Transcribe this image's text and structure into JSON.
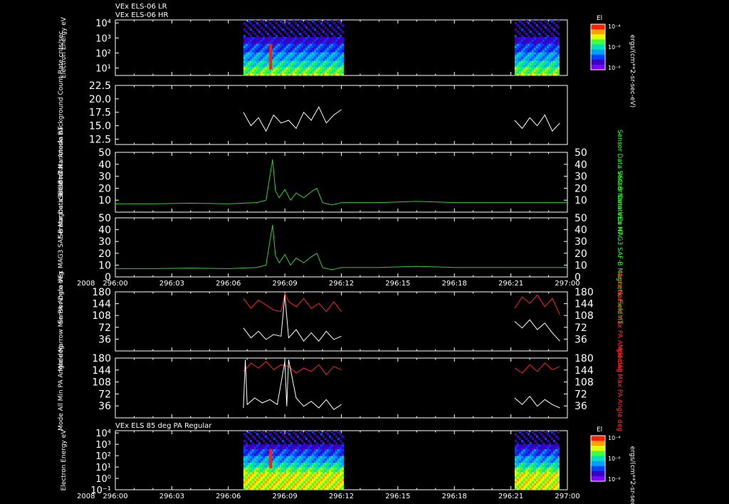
{
  "header": {
    "line1": "VEx ELS-06 LR",
    "line2": "VEx ELS-06 HR",
    "lower_title": "VEx ELS 85 deg PA Regular"
  },
  "colorbars": [
    {
      "label": "El",
      "ticks": [
        "10⁻⁴",
        "10⁻⁶",
        "10⁻⁸"
      ],
      "unit": "ergs/(cm**2-sr-sec-eV)"
    },
    {
      "label": "El",
      "ticks": [
        "10⁻⁴",
        "10⁻⁶",
        "10⁻⁸"
      ],
      "unit": "ergs/(cm**2-sr-sec-eV)"
    }
  ],
  "time_axis": {
    "year": "2008",
    "ticks": [
      "296:00",
      "296:03",
      "296:06",
      "296:09",
      "296:12",
      "296:15",
      "296:18",
      "296:21",
      "297:00"
    ],
    "range_hours": [
      0,
      24
    ]
  },
  "chart_data": [
    {
      "type": "heatmap",
      "id": "spec_top",
      "ylabel": "Electron Energy eV",
      "yticks": [
        "10⁴",
        "10³",
        "10²",
        "10¹"
      ],
      "y_log_range": [
        0.5,
        4.2
      ],
      "intervals": [
        [
          6.8,
          12.1
        ],
        [
          21.2,
          23.6
        ]
      ],
      "features": [
        {
          "x": 8.25,
          "label": "peak"
        }
      ]
    },
    {
      "type": "line",
      "id": "background",
      "ylabel": "Sensor Data Anode Background Count Rate cnts/sec",
      "ylim": [
        11.5,
        22.5
      ],
      "yticks": [
        12.5,
        15.0,
        17.5,
        20.0,
        22.5
      ],
      "ytick_labels": [
        "12.5",
        "15.0",
        "17.5",
        "20.0",
        "22.5"
      ],
      "color": "#ffffff",
      "series": [
        {
          "x": [
            6.8,
            7.2,
            7.6,
            8.0,
            8.4,
            8.8,
            9.2,
            9.6,
            10.0,
            10.4,
            10.8,
            11.2,
            11.6,
            12.0
          ],
          "values": [
            17.5,
            15.0,
            16.5,
            14.0,
            17.0,
            15.5,
            16.0,
            14.5,
            17.5,
            16.0,
            18.5,
            15.5,
            17.0,
            18.0
          ]
        },
        {
          "x": [
            21.2,
            21.6,
            22.0,
            22.4,
            22.8,
            23.2,
            23.6
          ],
          "values": [
            16.0,
            14.5,
            16.5,
            15.0,
            17.0,
            14.0,
            15.5
          ]
        }
      ]
    },
    {
      "type": "line",
      "id": "bmag_vso",
      "ylabel": "Sensor Data S/C Btot Nanotesla nT",
      "ylabel_right": "Sensor Data VSO B Nanotesla nT",
      "ylim": [
        0,
        50
      ],
      "yticks": [
        10,
        20,
        30,
        40,
        50
      ],
      "ytick_labels": [
        "10",
        "20",
        "30",
        "40",
        "50"
      ],
      "color": "#33cc33",
      "series": [
        {
          "x": [
            0,
            2,
            4,
            6,
            7.5,
            8.0,
            8.2,
            8.35,
            8.5,
            8.7,
            9.0,
            9.3,
            9.6,
            10.0,
            10.4,
            10.7,
            11.0,
            11.5,
            12,
            14,
            16,
            18,
            20,
            22,
            24
          ],
          "values": [
            7,
            7,
            7.5,
            7,
            8,
            10,
            30,
            44,
            18,
            12,
            19,
            10,
            16,
            12,
            17,
            20,
            8,
            6,
            8,
            8,
            9,
            8,
            8,
            8,
            8
          ]
        }
      ]
    },
    {
      "type": "line",
      "id": "bmag_mag3",
      "ylabel": "Sensor Data VEx MAG3 SAF-B Magnetic Field nT",
      "ylabel_right": "Sensor Data VEx MAG3 SAF-B Magnetic Field nT",
      "ylim": [
        0,
        50
      ],
      "yticks": [
        0,
        10,
        20,
        30,
        40,
        50
      ],
      "ytick_labels": [
        "0",
        "10",
        "20",
        "30",
        "40",
        "50"
      ],
      "color": "#33cc33",
      "series": [
        {
          "x": [
            0,
            2,
            4,
            6,
            7.5,
            8.0,
            8.2,
            8.35,
            8.5,
            8.7,
            9.0,
            9.3,
            9.6,
            10.0,
            10.4,
            10.7,
            11.0,
            11.5,
            12,
            14,
            16,
            18,
            20,
            22,
            24
          ],
          "values": [
            7,
            7,
            7.5,
            7,
            8,
            10,
            30,
            44,
            18,
            12,
            19,
            10,
            16,
            12,
            17,
            20,
            8,
            6,
            8,
            8,
            9,
            8,
            8,
            8,
            8
          ]
        }
      ]
    },
    {
      "type": "line",
      "id": "narrow_pa",
      "ylabel": "Mode Narrow Min PA Angle deg",
      "ylabel_right": "Mode Narrow Max PA Angle deg",
      "ylim": [
        0,
        180
      ],
      "yticks": [
        36,
        72,
        108,
        144,
        180
      ],
      "ytick_labels": [
        "36",
        "72",
        "108",
        "144",
        "180"
      ],
      "series": [
        {
          "color": "#ff2020",
          "x": [
            6.8,
            7.2,
            7.6,
            8.0,
            8.4,
            8.8,
            9.0,
            9.2,
            9.6,
            10.0,
            10.4,
            10.8,
            11.2,
            11.6,
            12.0
          ],
          "values": [
            160,
            130,
            155,
            140,
            125,
            120,
            175,
            150,
            135,
            160,
            130,
            145,
            120,
            150,
            120
          ]
        },
        {
          "color": "#ff2020",
          "x": [
            21.2,
            21.6,
            22.0,
            22.4,
            22.8,
            23.2,
            23.6
          ],
          "values": [
            130,
            165,
            145,
            170,
            135,
            160,
            110
          ]
        },
        {
          "color": "#ffffff",
          "x": [
            6.8,
            7.2,
            7.6,
            8.0,
            8.4,
            8.8,
            9.0,
            9.2,
            9.6,
            10.0,
            10.4,
            10.8,
            11.2,
            11.6,
            12.0
          ],
          "values": [
            70,
            40,
            60,
            35,
            50,
            45,
            170,
            40,
            65,
            30,
            55,
            30,
            60,
            35,
            45
          ]
        },
        {
          "color": "#ffffff",
          "x": [
            21.2,
            21.6,
            22.0,
            22.4,
            22.8,
            23.2,
            23.6
          ],
          "values": [
            90,
            70,
            95,
            65,
            85,
            55,
            30
          ]
        }
      ]
    },
    {
      "type": "line",
      "id": "all_pa",
      "ylabel": "Mode All Min PA Angle deg",
      "ylabel_right": "Mode All Max PA Angle deg",
      "ylim": [
        0,
        180
      ],
      "yticks": [
        36,
        72,
        108,
        144,
        180
      ],
      "ytick_labels": [
        "36",
        "72",
        "108",
        "144",
        "180"
      ],
      "series": [
        {
          "color": "#ff2020",
          "x": [
            6.8,
            7.2,
            7.6,
            8.0,
            8.4,
            8.8,
            9.2,
            9.6,
            10.0,
            10.4,
            10.8,
            11.2,
            11.6,
            12.0
          ],
          "values": [
            140,
            165,
            150,
            170,
            145,
            160,
            155,
            135,
            150,
            140,
            160,
            130,
            155,
            145
          ]
        },
        {
          "color": "#ff2020",
          "x": [
            21.2,
            21.6,
            22.0,
            22.4,
            22.8,
            23.2,
            23.6
          ],
          "values": [
            150,
            135,
            160,
            140,
            165,
            145,
            155
          ]
        },
        {
          "color": "#ffffff",
          "x": [
            6.8,
            6.9,
            7.0,
            7.4,
            7.8,
            8.2,
            8.6,
            9.0,
            9.1,
            9.2,
            9.6,
            10.0,
            10.4,
            10.8,
            11.2,
            11.6,
            12.0
          ],
          "values": [
            30,
            175,
            40,
            60,
            45,
            55,
            40,
            170,
            35,
            175,
            60,
            35,
            50,
            30,
            55,
            25,
            40
          ]
        },
        {
          "color": "#ffffff",
          "x": [
            21.2,
            21.6,
            22.0,
            22.4,
            22.8,
            23.2,
            23.6
          ],
          "values": [
            60,
            40,
            65,
            35,
            55,
            40,
            30
          ]
        }
      ]
    },
    {
      "type": "heatmap",
      "id": "spec_bottom",
      "ylabel": "Electron Energy eV",
      "yticks": [
        "10⁴",
        "10³",
        "10²",
        "10¹",
        "10⁰",
        "10⁻¹"
      ],
      "y_log_range": [
        -1,
        4.2
      ],
      "intervals": [
        [
          6.8,
          12.1
        ],
        [
          21.2,
          23.6
        ]
      ],
      "features": [
        {
          "x": 8.25,
          "label": "peak"
        }
      ]
    }
  ]
}
